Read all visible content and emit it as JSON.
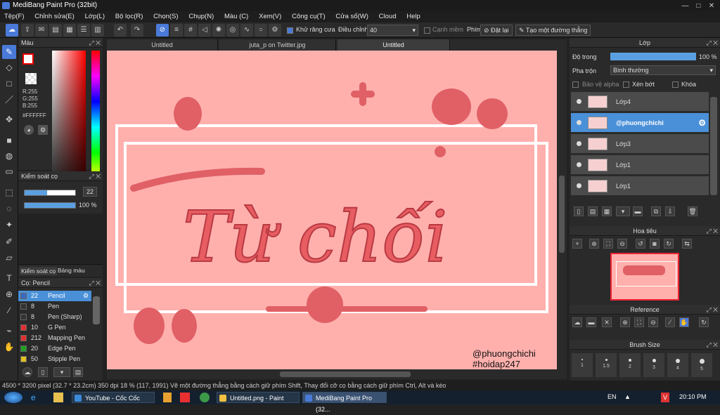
{
  "window": {
    "title": "MediBang Paint Pro (32bit)"
  },
  "menu": [
    "Tệp(F)",
    "Chỉnh sửa(E)",
    "Lớp(L)",
    "Bộ lọc(R)",
    "Chọn(S)",
    "Chụp(N)",
    "Màu (C)",
    "Xem(V)",
    "Công cụ(T)",
    "Cửa sổ(W)",
    "Cloud",
    "Help"
  ],
  "toolbar": {
    "antialias_label": "Khử răng cưa",
    "smoothing_label": "Điều chỉnh",
    "smoothing_value": "40",
    "canh_mem_label": "Cạnh mềm",
    "phim_label": "Phím",
    "reset_label": "Đặt lại",
    "straight_line_label": "Tạo một đường thẳng"
  },
  "color_panel": {
    "title": "Màu",
    "r": "R:255",
    "g": "G:255",
    "b": "B:255",
    "hex": "#FFFFFF"
  },
  "brush_control": {
    "title": "Kiểm soát cọ",
    "size": "22",
    "opacity": "100 %",
    "tab_control": "Kiểm soát cọ",
    "tab_palette": "Bảng màu"
  },
  "brush_list": {
    "title": "Cọ: Pencil",
    "items": [
      {
        "size": "22",
        "name": "Pencil",
        "color": "#3a6ac0",
        "selected": true
      },
      {
        "size": "8",
        "name": "Pen",
        "color": "#333333",
        "selected": false
      },
      {
        "size": "8",
        "name": "Pen (Sharp)",
        "color": "#333333",
        "selected": false
      },
      {
        "size": "10",
        "name": "G Pen",
        "color": "#e03030",
        "selected": false
      },
      {
        "size": "212",
        "name": "Mapping Pen",
        "color": "#e03030",
        "selected": false
      },
      {
        "size": "20",
        "name": "Edge Pen",
        "color": "#20a020",
        "selected": false
      },
      {
        "size": "50",
        "name": "Stipple Pen",
        "color": "#e0c020",
        "selected": false
      }
    ]
  },
  "tabs": [
    "Untitled",
    "juta_p on Twitter.jpg",
    "Untitled"
  ],
  "canvas": {
    "main_text": "Từ chối",
    "watermark_1": "@phuongchichi",
    "watermark_2": "#hoidap247"
  },
  "layer_panel": {
    "title": "Lớp",
    "opacity_label": "Độ trong",
    "opacity_value": "100 %",
    "blend_label": "Pha trộn",
    "blend_value": "Bình thường",
    "protect_alpha": "Bảo vệ alpha",
    "clipping": "Xén bớt",
    "lock": "Khóa",
    "layers": [
      {
        "name": "Lớp4",
        "selected": false
      },
      {
        "name": "@phuongchichi",
        "selected": true
      },
      {
        "name": "Lớp3",
        "selected": false
      },
      {
        "name": "Lớp1",
        "selected": false
      },
      {
        "name": "Lớp1",
        "selected": false
      }
    ]
  },
  "navigator": {
    "title": "Hoa tiêu"
  },
  "reference": {
    "title": "Reference"
  },
  "brush_size": {
    "title": "Brush Size",
    "values": [
      "1",
      "1.5",
      "2",
      "3",
      "4",
      "5"
    ]
  },
  "status": {
    "text": "4500 * 3200 pixel  (32.7 * 23.2cm)  350 dpi  18 %  (117, 1991)  Vẽ một đường thẳng bằng cách giữ phím Shift, Thay đổi cỡ cọ bằng cách giữ phím Ctrl, Alt và kéo"
  },
  "taskbar": {
    "items": [
      "YouTube - Cốc Cốc",
      "Untitled.png - Paint",
      "MediBang Paint Pro (32..."
    ],
    "lang": "EN",
    "time": "20:10 PM"
  },
  "colors": {
    "accent": "#4a7ad8",
    "canvas_bg": "#ffb0ad",
    "text_red": "#e85d62"
  }
}
